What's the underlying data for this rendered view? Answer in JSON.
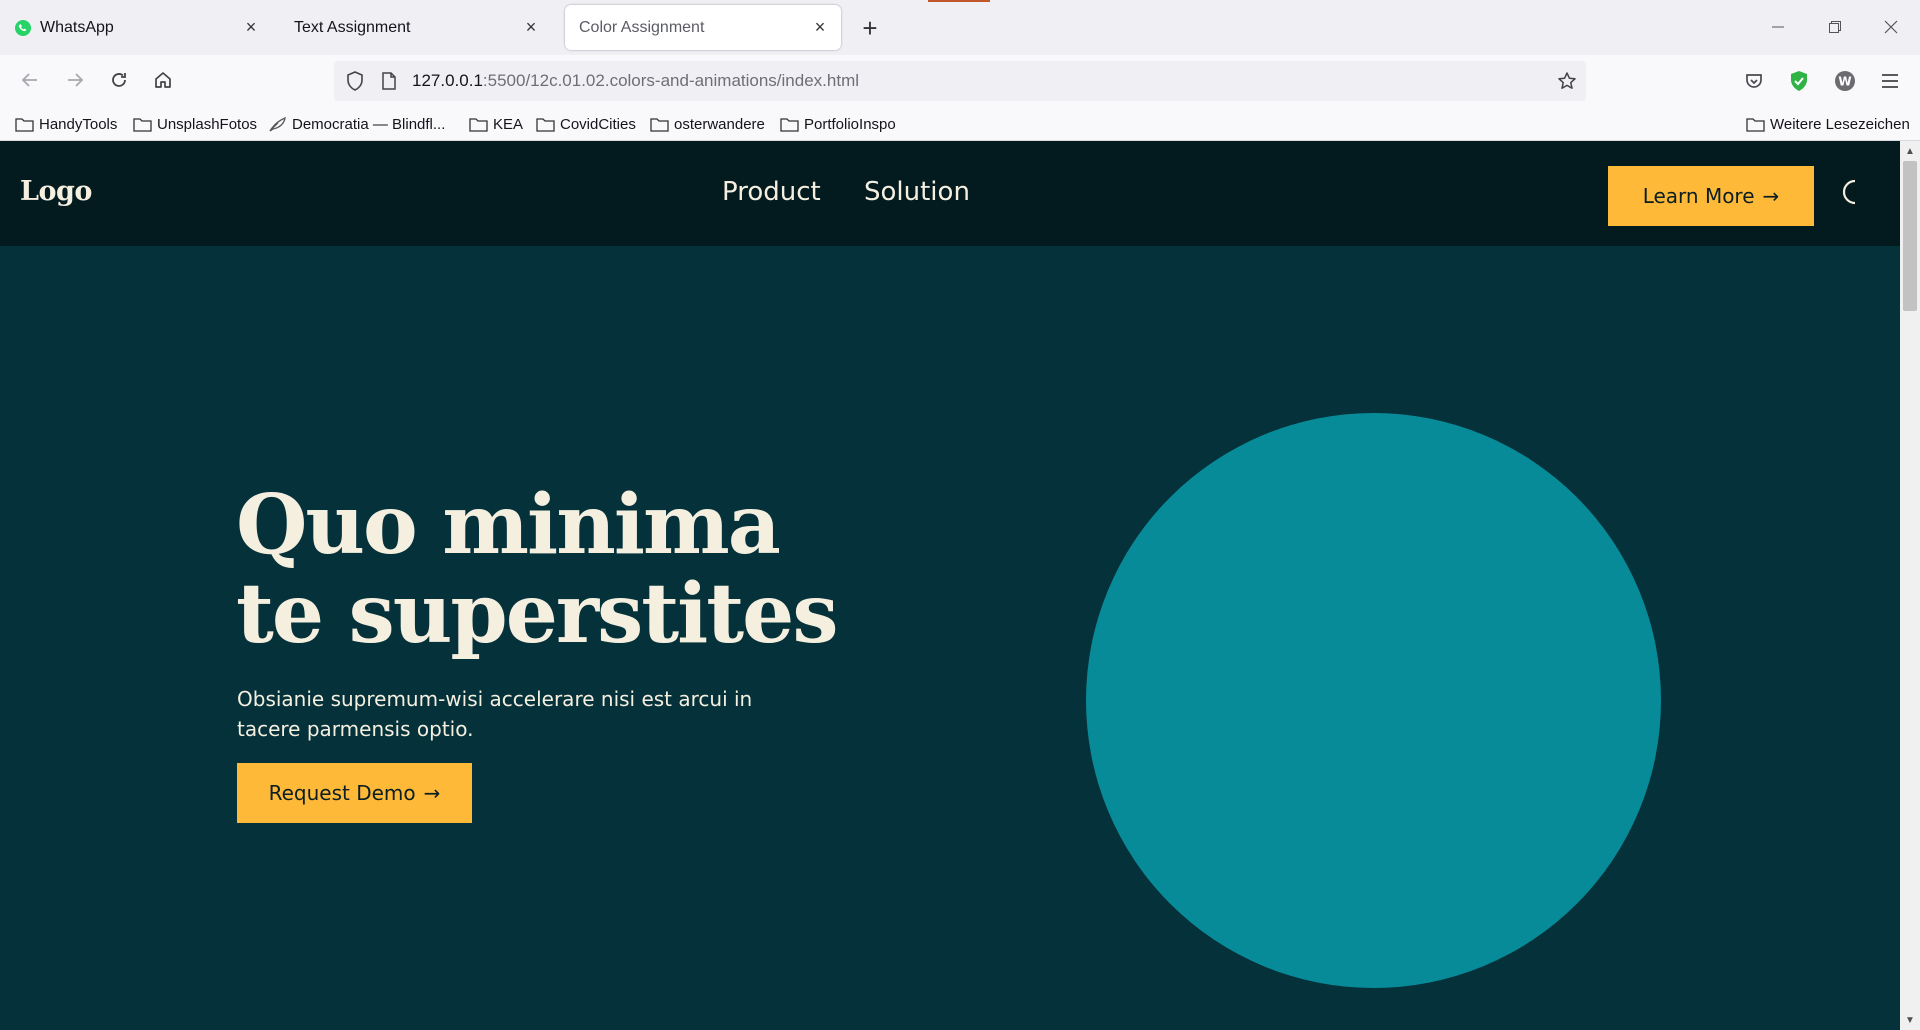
{
  "browser": {
    "tabs": [
      {
        "title": "WhatsApp",
        "icon": "whatsapp-icon",
        "active": false
      },
      {
        "title": "Text Assignment",
        "icon": "",
        "active": false
      },
      {
        "title": "Color Assignment",
        "icon": "",
        "active": true
      }
    ],
    "url_host": "127.0.0.1",
    "url_rest": ":5500/12c.01.02.colors-and-animations/index.html",
    "bookmarks": [
      {
        "label": "HandyTools",
        "icon": "folder-icon"
      },
      {
        "label": "UnsplashFotos",
        "icon": "folder-icon"
      },
      {
        "label": "Democratia — Blindfl...",
        "icon": "feather-icon"
      },
      {
        "label": "KEA",
        "icon": "folder-icon"
      },
      {
        "label": "CovidCities",
        "icon": "folder-icon"
      },
      {
        "label": "osterwandere",
        "icon": "folder-icon"
      },
      {
        "label": "PortfolioInspo",
        "icon": "folder-icon"
      }
    ],
    "other_bookmarks": "Weitere Lesezeichen",
    "extensions": [
      {
        "icon": "pocket-icon",
        "color": "#4a4a4f"
      },
      {
        "icon": "shield-check-icon",
        "color": "#2fb344"
      },
      {
        "icon": "w-avatar-icon",
        "color": "#6b6b70",
        "letter": "W"
      }
    ]
  },
  "site": {
    "logo": "Logo",
    "nav": [
      "Product",
      "Solution"
    ],
    "cta": "Learn More",
    "arrow": "→",
    "hero": {
      "title_line1": "Quo minima",
      "title_line2": "te superstites",
      "subtitle": "Obsianie supremum-wisi accelerare nisi est arcui in tacere parmensis optio.",
      "button": "Request Demo"
    },
    "colors": {
      "header_bg": "#031b1f",
      "hero_bg": "#04313a",
      "accent": "#ffb938",
      "circle": "#088b99",
      "text": "#f5efe0"
    }
  }
}
